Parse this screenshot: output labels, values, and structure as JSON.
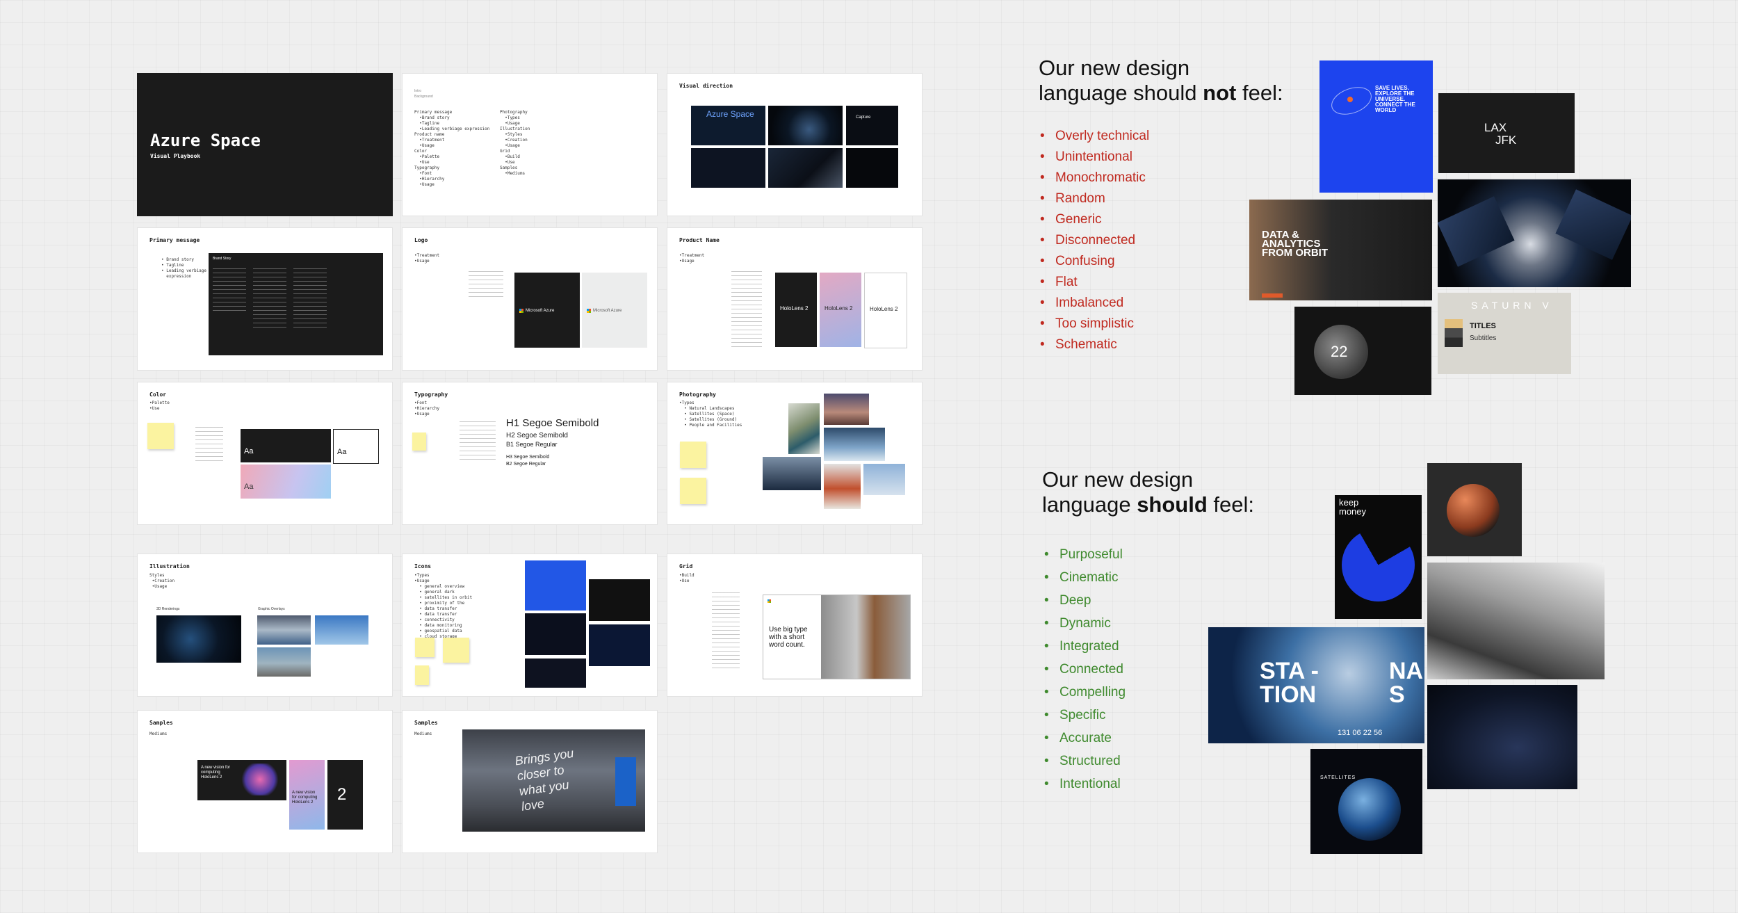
{
  "slides": {
    "title": {
      "title": "Azure Space",
      "subtitle": "Visual Playbook"
    },
    "agenda": {
      "labels": [
        "Intro",
        "Background"
      ],
      "col1": "Primary message\n  •Brand story\n  •Tagline\n  •Leading verbiage expression\nProduct name\n  •Treatment\n  •Usage\nColor\n  •Palette\n  •Use\nTypography\n  •Font\n  •Hierarchy\n  •Usage",
      "col2": "Photography\n  •Types\n  •Usage\nIllustration\n  •Styles\n  •Creation\n  •Usage\nGrid\n  •Build\n  •Use\nSamples\n  •Mediums"
    },
    "visual_direction": {
      "title": "Visual direction",
      "card1": "Azure Space",
      "card3": "Capture"
    },
    "primary_message": {
      "title": "Primary message",
      "bullets": "• Brand story\n• Tagline\n• Leading verbiage\n  expression",
      "panel_heading": "Brand Story"
    },
    "logo": {
      "title": "Logo",
      "bullets": "•Treatment\n•Usage",
      "dark_label": "Microsoft Azure",
      "light_label": "Microsoft Azure"
    },
    "product_name": {
      "title": "Product Name",
      "bullets": "•Treatment\n•Usage",
      "cards": [
        "HoloLens 2",
        "HoloLens 2",
        "HoloLens 2"
      ]
    },
    "color": {
      "title": "Color",
      "bullets": "•Palette\n•Use",
      "swatch": "Aa"
    },
    "typography": {
      "title": "Typography",
      "bullets": "•Font\n•Hierarchy\n•Usage",
      "h1": "H1 Segoe Semibold",
      "h2": "H2 Segoe Semibold",
      "b1": "B1 Segoe Regular",
      "h3": "H3 Segoe Semibold",
      "b2": "B2 Segoe Regular"
    },
    "photography": {
      "title": "Photography",
      "bullets": "•Types\n  • Natural Landscapes\n  • Satellites (Space)\n  • Satellites (Ground)\n  • People and Facilities"
    },
    "illustration": {
      "title": "Illustration",
      "bullets": "Styles\n •Creation\n •Usage",
      "label1": "3D Renderings",
      "label2": "Graphic Overlays"
    },
    "icons": {
      "title": "Icons",
      "bullets": "•Types\n•Usage\n  • general overview\n  • general dark\n  • satellites in orbit\n  • proximity of the\n  • data transfer\n  • data transfer\n  • connectivity\n  • data monitoring\n  • geospatial data\n  • cloud storage"
    },
    "grid": {
      "title": "Grid",
      "bullets": "•Build\n•Use",
      "sample_text": "Use big type with a short word count."
    },
    "samples1": {
      "title": "Samples",
      "sub": "Mediums",
      "card_text": "A new vision for computing HoloLens 2",
      "card_text2": "A new vision for computing HoloLens 2",
      "digit": "2"
    },
    "samples2": {
      "title": "Samples",
      "sub": "Mediums",
      "mural": "Brings you closer to what you love"
    }
  },
  "not_feel": {
    "heading_pre": "Our new design",
    "heading_mid": "language should ",
    "heading_bold": "not",
    "heading_post": " feel:",
    "items": [
      "Overly technical",
      "Unintentional",
      "Monochromatic",
      "Random",
      "Generic",
      "Disconnected",
      "Confusing",
      "Flat",
      "Imbalanced",
      "Too simplistic",
      "Schematic"
    ],
    "board": {
      "poster": "SAVE LIVES. EXPLORE THE UNIVERSE. CONNECT THE WORLD",
      "lax": "LAX",
      "jfk": "JFK",
      "data": "DATA & ANALYTICS FROM ORBIT",
      "num": "22",
      "saturn": "SATURN V",
      "titles": "TITLES",
      "subtitles": "Subtitles"
    }
  },
  "should_feel": {
    "heading_pre": "Our new design",
    "heading_mid": "language ",
    "heading_bold": "should",
    "heading_post": " feel:",
    "items": [
      "Purposeful",
      "Cinematic",
      "Deep",
      "Dynamic",
      "Integrated",
      "Connected",
      "Compelling",
      "Specific",
      "Accurate",
      "Structured",
      "Intentional"
    ],
    "board": {
      "keep": "keep money",
      "station": "STA -TION",
      "na": "NA S",
      "count": "131  06  22  56",
      "satellites": "SATELLITES"
    }
  },
  "colors": {
    "bad": "#c0291f",
    "good": "#3f8a2e",
    "dark": "#1b1b1b"
  }
}
